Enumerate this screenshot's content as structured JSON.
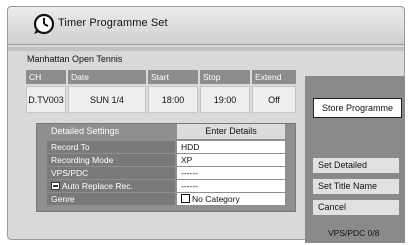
{
  "window": {
    "title": "Timer Programme Set",
    "programme_name": "Manhattan Open Tennis"
  },
  "schedule": {
    "headers": {
      "ch": "CH",
      "date": "Date",
      "start": "Start",
      "stop": "Stop",
      "extend": "Extend"
    },
    "values": {
      "ch": "D.TV003",
      "date": "SUN 1/4",
      "start": "18:00",
      "stop": "19:00",
      "extend": "Off"
    }
  },
  "detailed": {
    "heading": "Detailed Settings",
    "enter_details": "Enter Details",
    "rows": [
      {
        "label": "Record To",
        "value": "HDD"
      },
      {
        "label": "Recording Mode",
        "value": "XP"
      },
      {
        "label": "VPS/PDC",
        "value": "------"
      },
      {
        "label": "Auto Replace Rec.",
        "value": "------",
        "icon": "auto-replace-icon"
      },
      {
        "label": "Genre",
        "value": "No Category",
        "icon": "checkbox"
      }
    ]
  },
  "side": {
    "store_programme": "Store Programme",
    "set_detailed": "Set Detailed",
    "set_title_name": "Set Title Name",
    "cancel": "Cancel",
    "vps_counter": "VPS/PDC 0/8"
  },
  "icons": {
    "title": "clock-icon"
  },
  "colors": {
    "header_bg": "#8c8c8c",
    "side_panel_bg": "#8a8a8a",
    "highlight_button_bg": "#ffffff"
  }
}
